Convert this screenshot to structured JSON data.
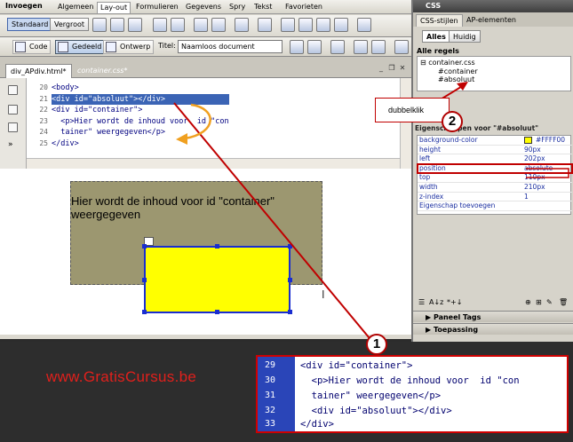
{
  "insert_bar": {
    "title": "Invoegen",
    "tabs": [
      "Algemeen",
      "Lay-out",
      "Formulieren",
      "Gegevens",
      "Spry",
      "Tekst",
      "Favorieten"
    ],
    "active_tab": "Lay-out",
    "modes": [
      "Standaard",
      "Vergroot"
    ]
  },
  "doc_toolbar": {
    "buttons": [
      "Code",
      "Gedeeld",
      "Ontwerp"
    ],
    "active": "Gedeeld",
    "title_label": "Titel:",
    "title_value": "Naamloos document"
  },
  "doc_tabs": [
    "div_APdiv.html*",
    "container.css*"
  ],
  "code": {
    "line_numbers": [
      "20",
      "21",
      "22",
      "23",
      "24",
      "25"
    ],
    "lines": [
      "<body>",
      "<div id=\"absoluut\"></div>",
      "<div id=\"container\">",
      "  <p>Hier wordt de inhoud voor  id \"con",
      "  tainer\" weergegeven</p>",
      "</div>"
    ],
    "selected_line_index": 1
  },
  "design": {
    "container_text": "Hier wordt de inhoud voor id \"container\" weergegeven",
    "container_color": "#9c9770",
    "absolute_color": "#ffff00"
  },
  "panel": {
    "title": "CSS",
    "tabs": [
      "CSS-stijlen",
      "AP-elementen"
    ],
    "mode_buttons": [
      "Alles",
      "Huidig"
    ],
    "all_rules_label": "Alle regels",
    "tree": [
      "container.css",
      "#container",
      "#absoluut"
    ],
    "props_header": "Eigenschappen voor \"#absoluut\"",
    "properties": [
      {
        "key": "background-color",
        "value": "#FFFF00"
      },
      {
        "key": "height",
        "value": "90px"
      },
      {
        "key": "left",
        "value": "202px"
      },
      {
        "key": "position",
        "value": "absolute"
      },
      {
        "key": "top",
        "value": "110px"
      },
      {
        "key": "width",
        "value": "210px"
      },
      {
        "key": "z-index",
        "value": "1"
      }
    ],
    "add_property": "Eigenschap toevoegen",
    "bottom_panels": [
      "Paneel Tags",
      "Toepassing"
    ]
  },
  "callout": {
    "text": "dubbelklik",
    "number_one": "1",
    "number_two": "2"
  },
  "site": "www.GratisCursus.be",
  "zoom_code": {
    "line_numbers": [
      "29",
      "30",
      "31",
      "32",
      "33"
    ],
    "lines": [
      "<div id=\"container\">",
      "  <p>Hier wordt de inhoud voor  id \"con",
      "  tainer\" weergegeven</p>",
      "  <div id=\"absoluut\"></div>",
      "</div>"
    ]
  }
}
